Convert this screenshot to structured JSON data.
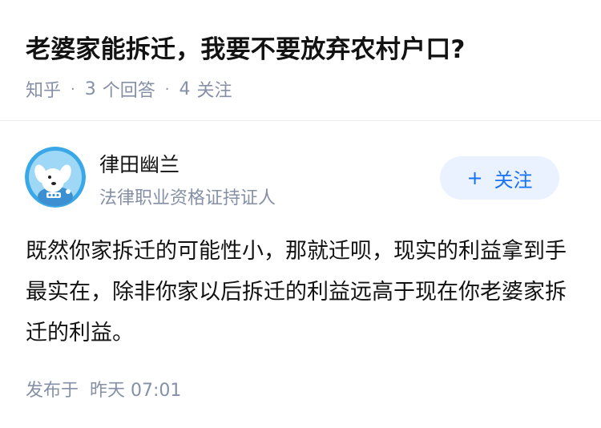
{
  "question": {
    "title": "老婆家能拆迁，我要不要放弃农村户口?",
    "source": "知乎",
    "separator": "·",
    "answer_count": "3",
    "answer_label": "个回答",
    "follower_count": "4",
    "follower_label": "关注"
  },
  "author": {
    "name": "律田幽兰",
    "title": "法律职业资格证持证人",
    "avatar_icon": "cartoon-dog-avatar"
  },
  "follow_button": {
    "icon": "+",
    "label": "关注"
  },
  "answer": {
    "content": "既然你家拆迁的可能性小，那就迁呗，现实的利益拿到手最实在，除非你家以后拆迁的利益远高于现在你老婆家拆迁的利益。"
  },
  "post_meta": {
    "label": "发布于",
    "time": "昨天 07:01"
  },
  "colors": {
    "accent": "#1772f6",
    "button_bg": "#eaf2ff",
    "muted_text": "#8590a6",
    "divider": "#ebebeb"
  }
}
